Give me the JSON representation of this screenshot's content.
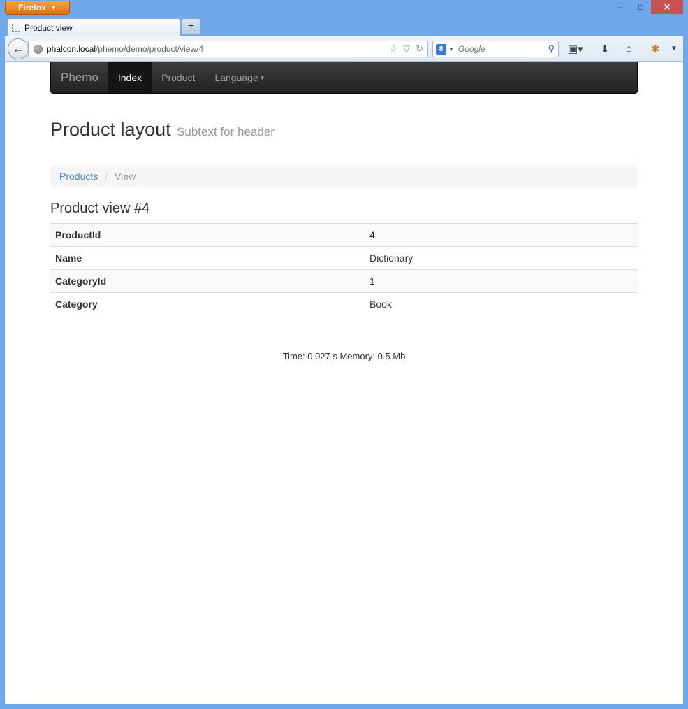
{
  "browser": {
    "menu_label": "Firefox",
    "tab_title": "Product view",
    "url_host": "phalcon.local",
    "url_path": "/phemo/demo/product/view/4",
    "search_engine_icon": "8",
    "search_placeholder": "Google",
    "window_controls": {
      "minimize": "–",
      "restore": "□",
      "close": "✕"
    }
  },
  "navbar": {
    "brand": "Phemo",
    "items": [
      {
        "label": "Index",
        "active": true
      },
      {
        "label": "Product",
        "active": false
      },
      {
        "label": "Language",
        "active": false,
        "dropdown": true
      }
    ]
  },
  "page": {
    "title": "Product layout",
    "subtitle": "Subtext for header"
  },
  "breadcrumb": {
    "items": [
      "Products",
      "View"
    ]
  },
  "detail": {
    "heading": "Product view #4",
    "rows": [
      {
        "key": "ProductId",
        "value": "4"
      },
      {
        "key": "Name",
        "value": "Dictionary"
      },
      {
        "key": "CategoryId",
        "value": "1"
      },
      {
        "key": "Category",
        "value": "Book"
      }
    ]
  },
  "footer": {
    "text": "Time: 0.027 s Memory: 0.5 Mb"
  },
  "colors": {
    "link": "#428bca",
    "navbar_bg": "#222222",
    "firefox_orange": "#e0700e"
  }
}
